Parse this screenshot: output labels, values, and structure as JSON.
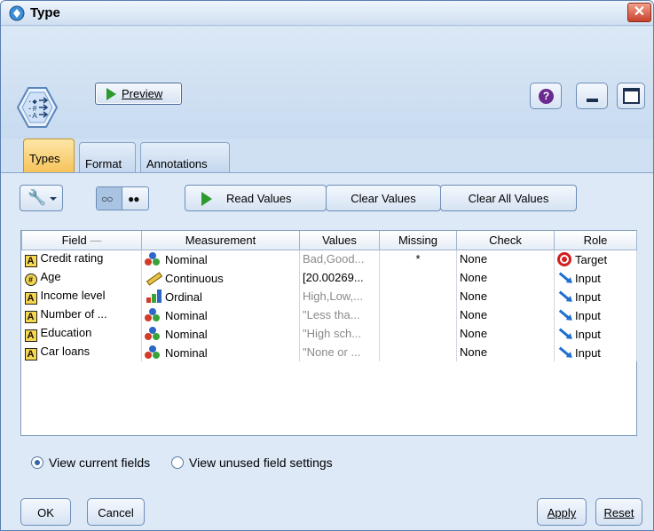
{
  "window": {
    "title": "Type",
    "close_glyph": "✕",
    "accent_color": "#f6c35a"
  },
  "toolbar": {
    "preview_label": "Preview",
    "help_glyph": "?"
  },
  "tabs": [
    {
      "label": "Types",
      "active": true
    },
    {
      "label": "Format",
      "active": false
    },
    {
      "label": "Annotations",
      "active": false
    }
  ],
  "actions": {
    "read_values": "Read Values",
    "clear_values": "Clear Values",
    "clear_all_values": "Clear All Values"
  },
  "table": {
    "columns": [
      "Field",
      "Measurement",
      "Values",
      "Missing",
      "Check",
      "Role"
    ],
    "sort_indicator": "—",
    "rows": [
      {
        "field": "Credit rating",
        "field_type": "A",
        "measurement": "Nominal",
        "measurement_icon": "nominal-icon",
        "values": "Bad,Good...",
        "missing": "*",
        "check": "None",
        "role": "Target",
        "role_icon": "target-icon"
      },
      {
        "field": "Age",
        "field_type": "#",
        "measurement": "Continuous",
        "measurement_icon": "continuous-icon",
        "values": "[20.00269...",
        "missing": "",
        "check": "None",
        "role": "Input",
        "role_icon": "input-arrow-icon"
      },
      {
        "field": "Income level",
        "field_type": "A",
        "measurement": "Ordinal",
        "measurement_icon": "ordinal-icon",
        "values": "High,Low,...",
        "missing": "",
        "check": "None",
        "role": "Input",
        "role_icon": "input-arrow-icon"
      },
      {
        "field": "Number of ...",
        "field_type": "A",
        "measurement": "Nominal",
        "measurement_icon": "nominal-icon",
        "values": "\"Less tha...",
        "missing": "",
        "check": "None",
        "role": "Input",
        "role_icon": "input-arrow-icon"
      },
      {
        "field": "Education",
        "field_type": "A",
        "measurement": "Nominal",
        "measurement_icon": "nominal-icon",
        "values": "\"High sch...",
        "missing": "",
        "check": "None",
        "role": "Input",
        "role_icon": "input-arrow-icon"
      },
      {
        "field": "Car loans",
        "field_type": "A",
        "measurement": "Nominal",
        "measurement_icon": "nominal-icon",
        "values": "\"None or ...",
        "missing": "",
        "check": "None",
        "role": "Input",
        "role_icon": "input-arrow-icon"
      }
    ]
  },
  "view_options": {
    "current_fields": "View current fields",
    "unused_settings": "View unused field settings",
    "selected": "current_fields"
  },
  "buttons": {
    "ok": "OK",
    "cancel": "Cancel",
    "apply": "Apply",
    "reset": "Reset"
  }
}
